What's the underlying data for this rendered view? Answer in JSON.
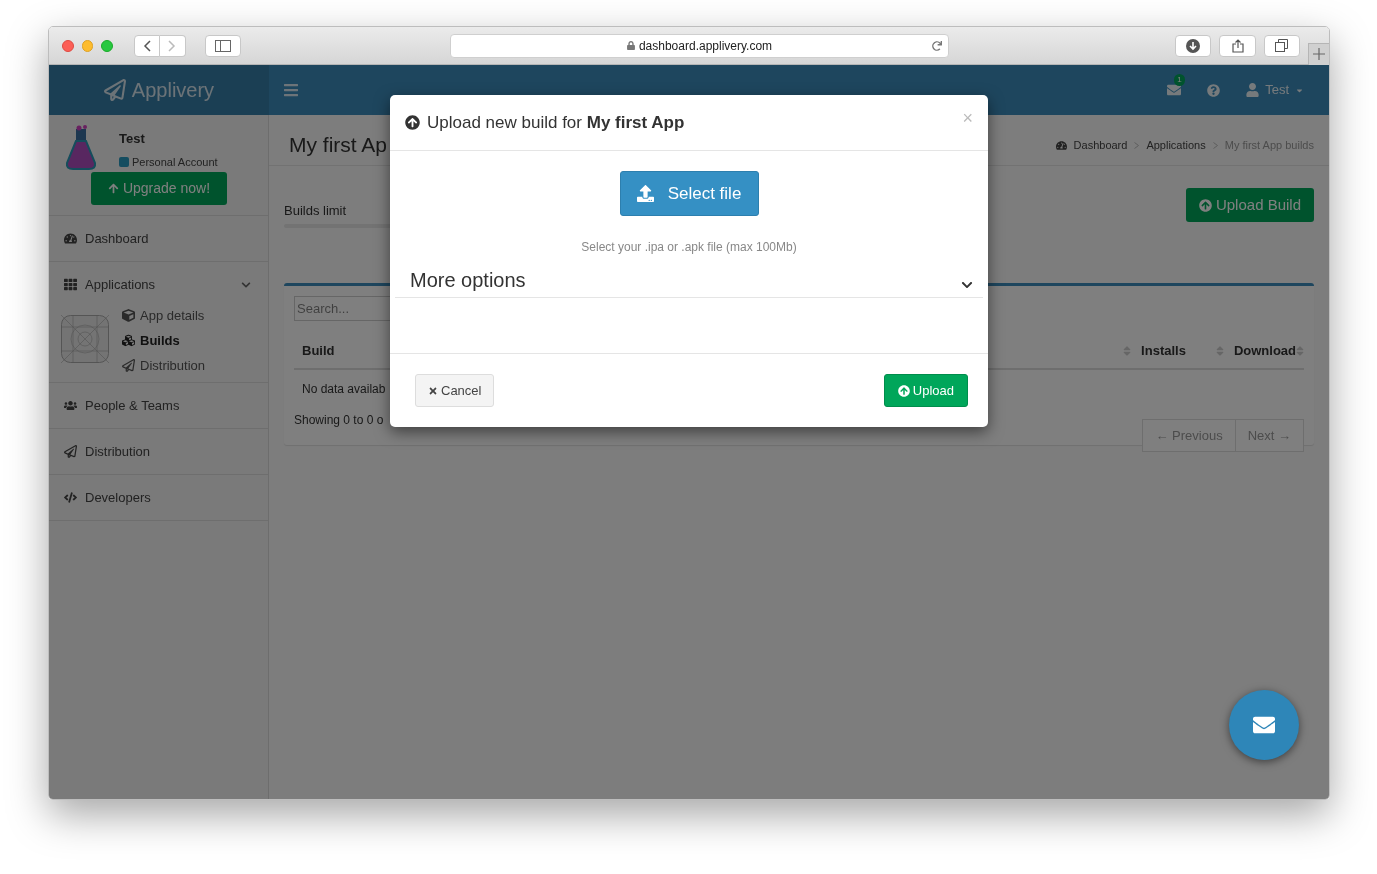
{
  "browser": {
    "url": "dashboard.applivery.com"
  },
  "header": {
    "brand": "Applivery",
    "notification_count": "1",
    "user": "Test"
  },
  "sidebar": {
    "account_name": "Test",
    "account_type": "Personal Account",
    "upgrade_button": "Upgrade now!",
    "items": [
      {
        "label": "Dashboard"
      },
      {
        "label": "Applications",
        "expanded": true,
        "children": [
          {
            "label": "App details",
            "selected": false
          },
          {
            "label": "Builds",
            "selected": true
          },
          {
            "label": "Distribution",
            "selected": false
          }
        ]
      },
      {
        "label": "People & Teams"
      },
      {
        "label": "Distribution"
      },
      {
        "label": "Developers"
      }
    ]
  },
  "main": {
    "title": "My first Ap",
    "breadcrumbs": [
      {
        "label": "Dashboard",
        "selected": false
      },
      {
        "label": "Applications",
        "selected": false
      },
      {
        "label": "My first App builds",
        "selected": true
      }
    ],
    "builds_limit": {
      "label": "Builds limit"
    },
    "upload_button": "Upload Build",
    "table": {
      "search_placeholder": "Search...",
      "columns": [
        "Build",
        "Installs",
        "Download"
      ],
      "empty_message": "No data availab",
      "info": "Showing 0 to 0 o",
      "pagination": [
        {
          "label": "← Previous",
          "disabled": true
        },
        {
          "label": "Next →",
          "disabled": true
        }
      ]
    }
  },
  "modal": {
    "title": "Upload new build for **My first App**",
    "close": "×",
    "select_button": "Select file",
    "hint": "Select your .ipa or .apk file (max 100Mb)",
    "more_options": {
      "label": "More options",
      "expanded": false
    },
    "cancel": "Cancel",
    "upload": "Upload"
  }
}
